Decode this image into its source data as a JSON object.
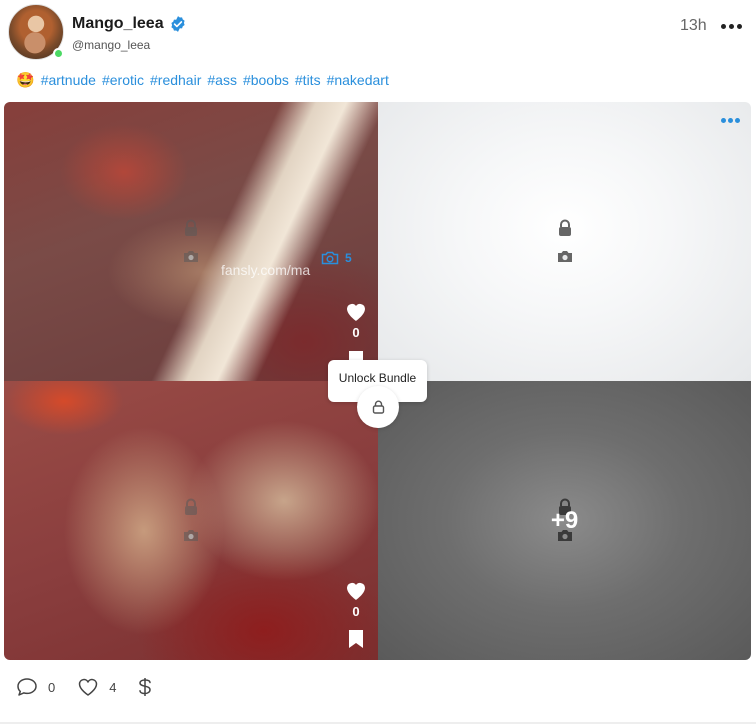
{
  "post": {
    "display_name": "Mango_leea",
    "username": "@mango_leea",
    "timestamp": "13h",
    "caption_emoji": "🤩",
    "hashtags": [
      "#artnude",
      "#erotic",
      "#redhair",
      "#ass",
      "#boobs",
      "#tits",
      "#nakedart"
    ]
  },
  "media": {
    "tile1": {
      "likes": "0"
    },
    "tile3": {
      "likes": "0"
    },
    "watermark": "fansly.com/ma",
    "media_count": "5",
    "more_count": "+9"
  },
  "tooltip": {
    "label": "Unlock Bundle"
  },
  "footer": {
    "comments": "0",
    "likes": "4"
  },
  "colors": {
    "accent": "#2a8fdc",
    "online": "#4cd964"
  },
  "icons": [
    "verified-icon",
    "more-icon",
    "lock-icon",
    "camera-icon",
    "heart-icon",
    "bookmark-icon",
    "comment-icon",
    "dollar-icon"
  ]
}
